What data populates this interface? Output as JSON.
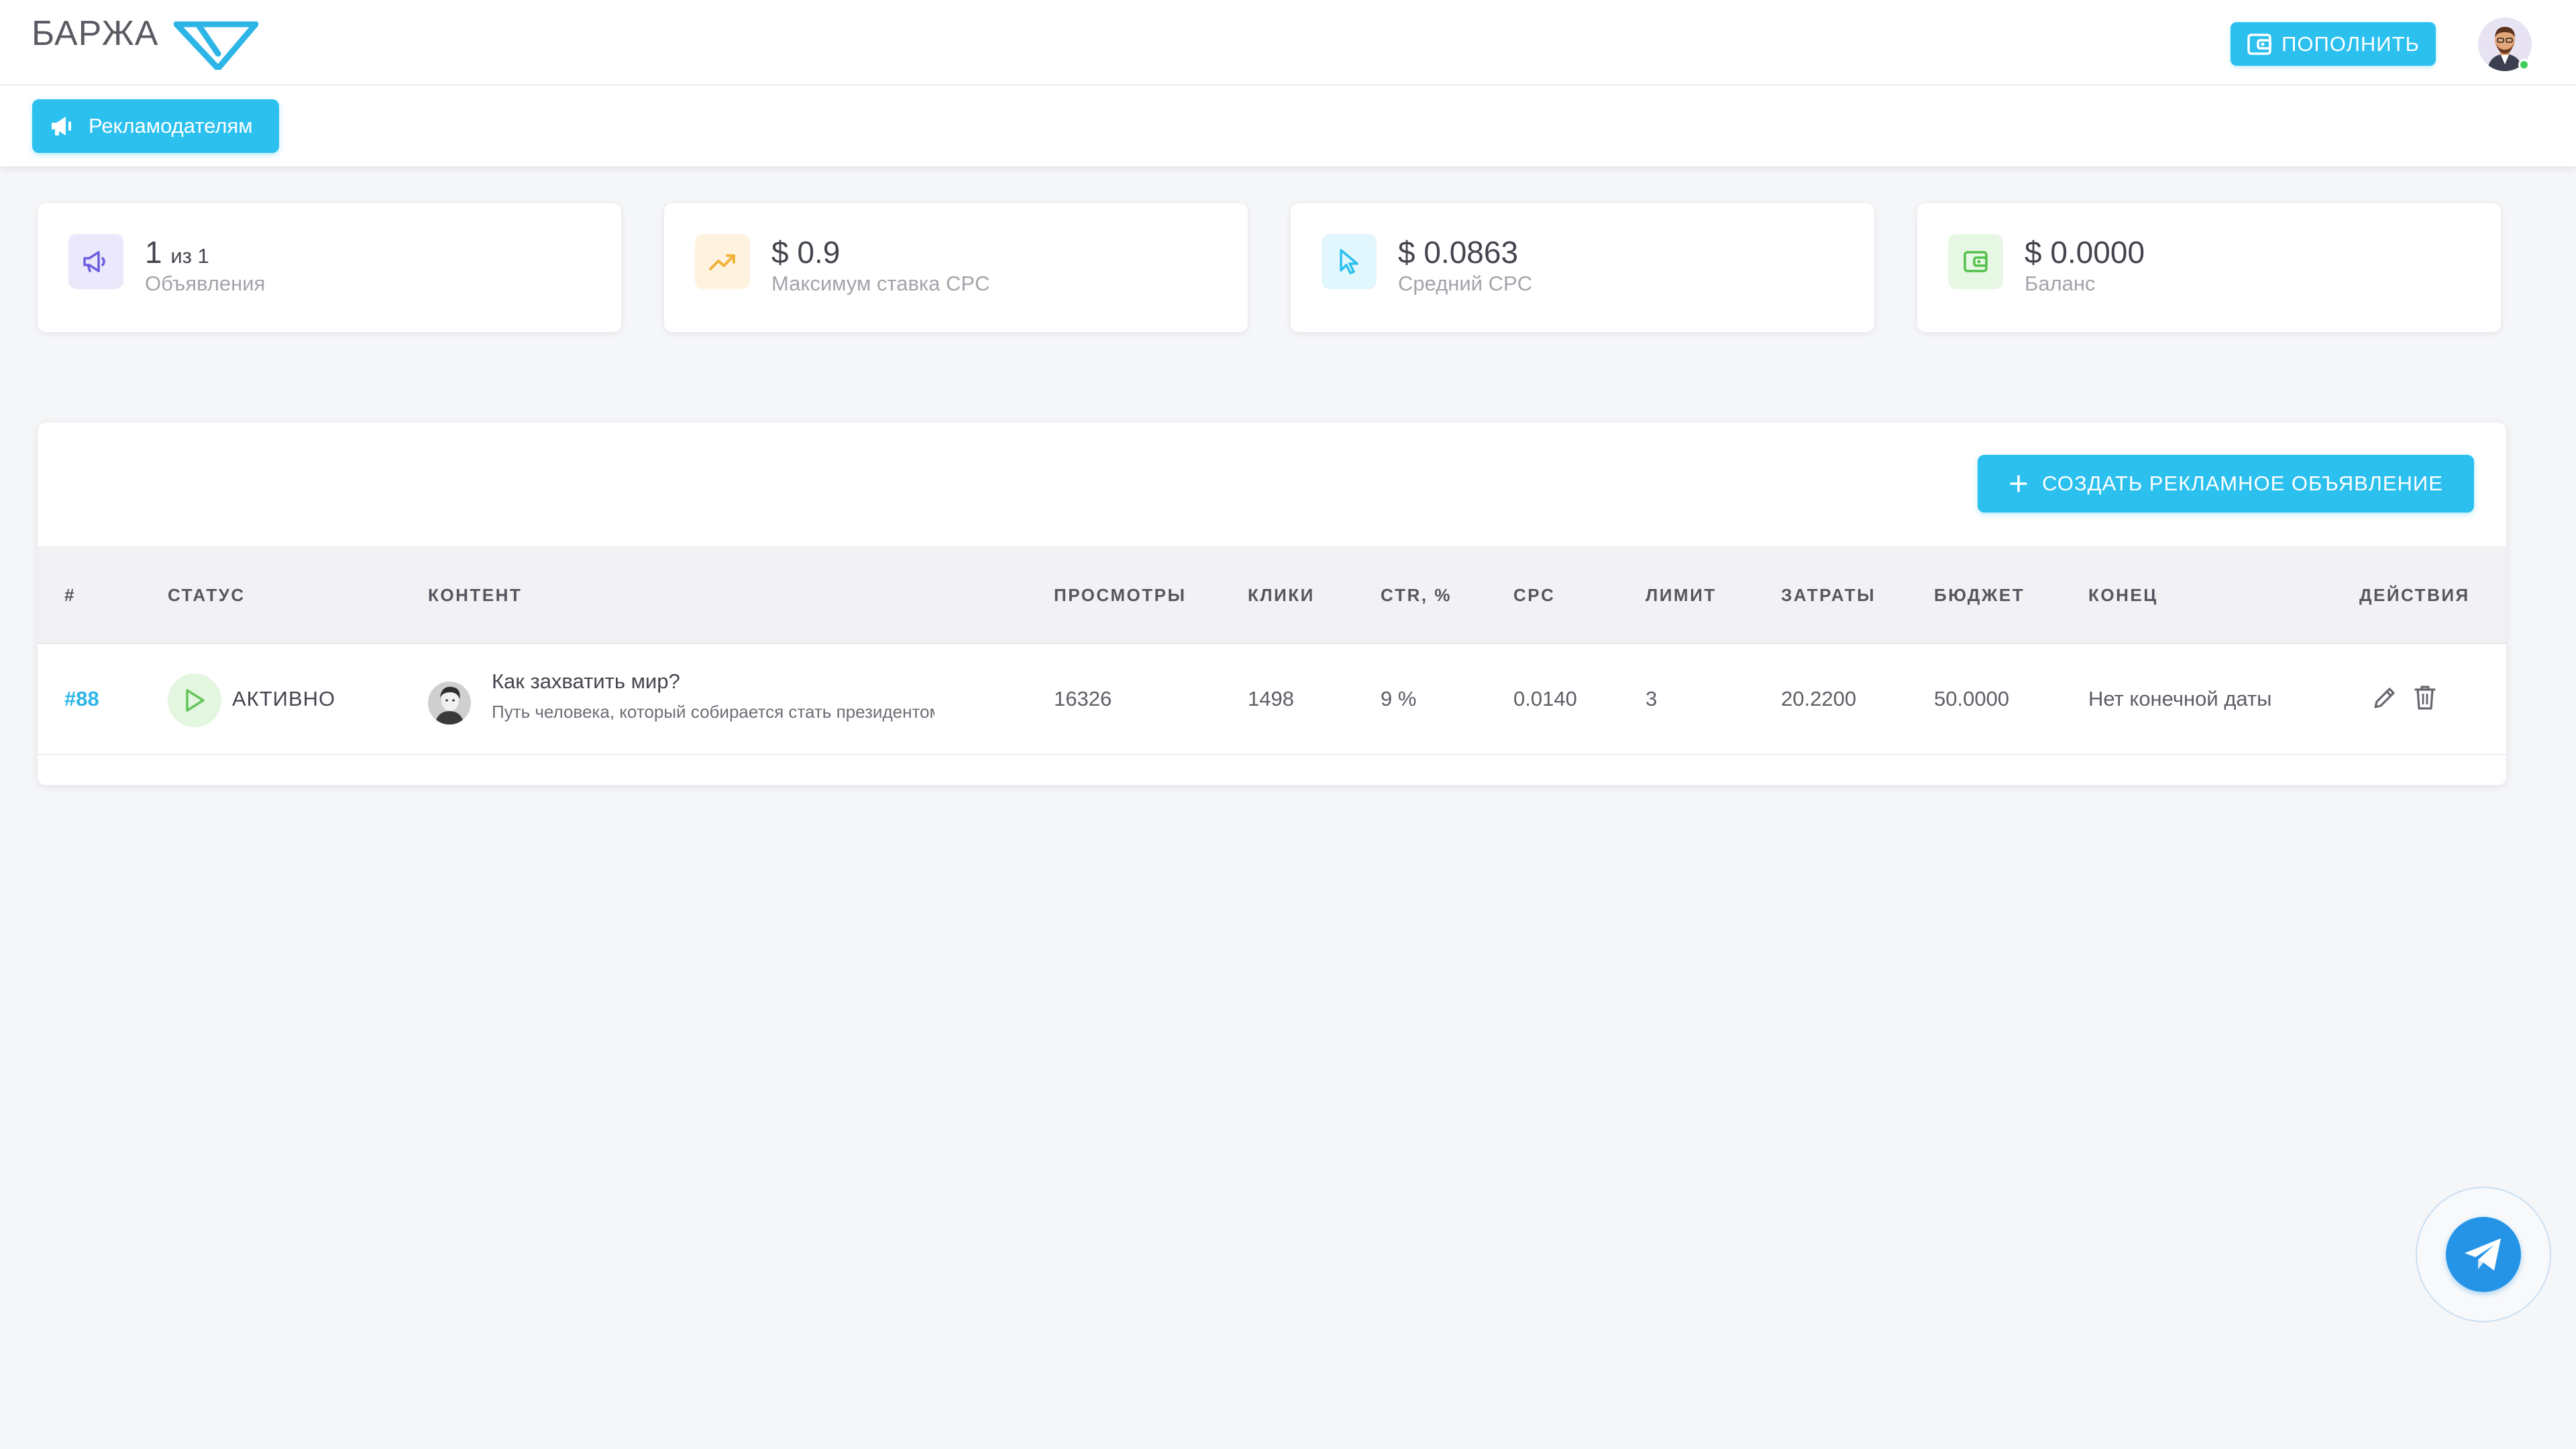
{
  "header": {
    "logo_text": "БАРЖА",
    "topup_label": "ПОПОЛНИТЬ",
    "topup_icon": "wallet-icon",
    "avatar_alt": "user-avatar"
  },
  "nav": {
    "advertisers_label": "Рекламодателям",
    "advertisers_icon": "megaphone-icon"
  },
  "stats": [
    {
      "value": "1",
      "value_suffix": "из 1",
      "label": "Объявления",
      "icon": "megaphone-icon",
      "icon_bg": "#ebe8fb",
      "icon_color": "#6a5ee0"
    },
    {
      "value": "$ 0.9",
      "label": "Максимум ставка CPC",
      "icon": "trending-up-icon",
      "icon_bg": "#fff3e0",
      "icon_color": "#f2b13a"
    },
    {
      "value": "$ 0.0863",
      "label": "Средний CPC",
      "icon": "cursor-icon",
      "icon_bg": "#e2f6fd",
      "icon_color": "#2cc0ef"
    },
    {
      "value": "$ 0.0000",
      "label": "Баланс",
      "icon": "wallet-icon",
      "icon_bg": "#e6f8e3",
      "icon_color": "#53c14c"
    }
  ],
  "table": {
    "create_label": "СОЗДАТЬ РЕКЛАМНОЕ ОБЪЯВЛЕНИЕ",
    "columns": [
      "#",
      "СТАТУС",
      "КОНТЕНТ",
      "ПРОСМОТРЫ",
      "КЛИКИ",
      "CTR, %",
      "CPC",
      "ЛИМИТ",
      "ЗАТРАТЫ",
      "БЮДЖЕТ",
      "КОНЕЦ",
      "ДЕЙСТВИЯ"
    ],
    "rows": [
      {
        "id": "#88",
        "status": "АКТИВНО",
        "title": "Как захватить мир?",
        "description": "Путь человека, который собирается стать президентом",
        "views": "16326",
        "clicks": "1498",
        "ctr": "9 %",
        "cpc": "0.0140",
        "limit": "3",
        "spent": "20.2200",
        "budget": "50.0000",
        "end": "Нет конечной даты"
      }
    ]
  },
  "colors": {
    "accent": "#2cc0ef",
    "active_green": "#63c45a",
    "telegram": "#2594e6"
  }
}
